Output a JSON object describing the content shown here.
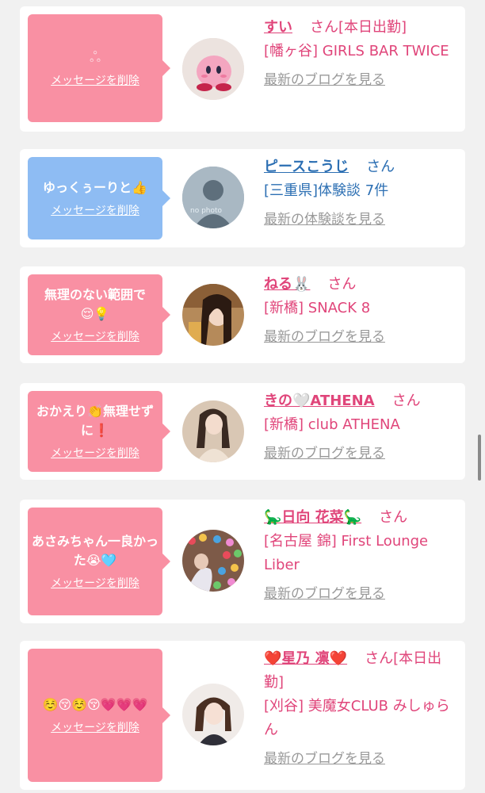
{
  "cards": [
    {
      "message": "ஃ",
      "delete_label": "メッセージを削除",
      "name": "すい",
      "san": "さん",
      "extra": "[本日出勤]",
      "place": "[幡ヶ谷] GIRLS BAR TWICE",
      "link": "最新のブログを見る"
    },
    {
      "message": "ゆっくぅーりと👍",
      "delete_label": "メッセージを削除",
      "name": "ピースこうじ",
      "san": "さん",
      "place": "[三重県]体験談 7件",
      "link": "最新の体験談を見る",
      "avatar_text": "no photo"
    },
    {
      "message": "無理のない範囲で😌💡",
      "delete_label": "メッセージを削除",
      "name": "ねる🐰",
      "san": "さん",
      "place": "[新橋] SNACK 8",
      "link": "最新のブログを見る"
    },
    {
      "message": "おかえり👏無理せずに❗",
      "delete_label": "メッセージを削除",
      "name": "きの🤍ATHENA",
      "san": "さん",
      "place": "[新橋] club ATHENA",
      "link": "最新のブログを見る"
    },
    {
      "message": "あさみちゃん一良かった😭🩵",
      "delete_label": "メッセージを削除",
      "name": "🦕日向 花菜🦕",
      "san": "さん",
      "place": "[名古屋 錦] First Lounge Liber",
      "link": "最新のブログを見る"
    },
    {
      "message": "☺️😚☺️😚💗💗💗",
      "delete_label": "メッセージを削除",
      "name": "❤️星乃 凛❤️",
      "san": "さん",
      "extra": "[本日出勤]",
      "place": "[刈谷] 美魔女CLUB みしゅらん",
      "link": "最新のブログを見る"
    }
  ],
  "colors": {
    "pink": "#f990a3",
    "blue": "#8ebcf3",
    "name_pink": "#e0457a",
    "name_blue": "#2c6fb3"
  }
}
